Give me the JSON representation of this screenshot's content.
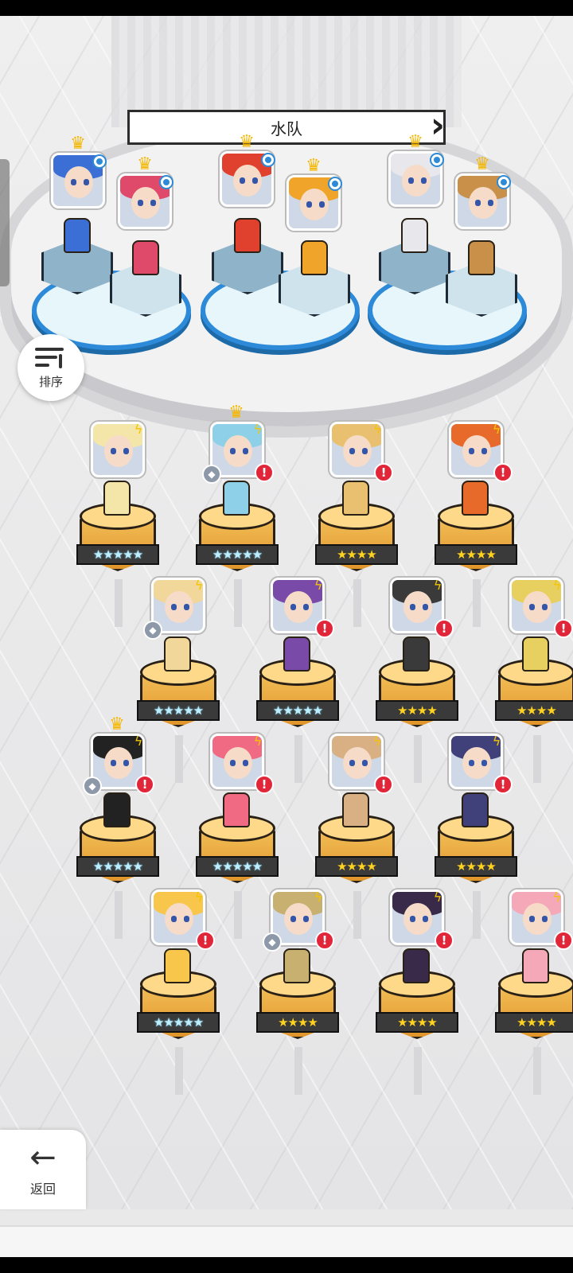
{
  "team": {
    "title": "水队",
    "prev_icon": "chevron-left-icon",
    "next_icon": "chevron-right-icon"
  },
  "sort_button": {
    "label": "排序",
    "icon": "sort-descending-icon"
  },
  "back_button": {
    "label": "返回",
    "icon": "arrow-left-icon"
  },
  "star_glyph": "★",
  "colors": {
    "team_ring": "#2d8ad8",
    "alert": "#e2263a",
    "gold_pedestal": "#f6c660",
    "five_star": "#bfefff",
    "four_star": "#ffd21f"
  },
  "team_members": [
    {
      "slot": 1,
      "hair": "#3c6fd6",
      "crown": true,
      "selected_marker": true
    },
    {
      "slot": 2,
      "hair": "#e04a6a",
      "crown": true,
      "selected_marker": true
    },
    {
      "slot": 3,
      "hair": "#e0402e",
      "crown": true,
      "selected_marker": true
    },
    {
      "slot": 4,
      "hair": "#f0a52a",
      "crown": true,
      "selected_marker": true
    },
    {
      "slot": 5,
      "hair": "#e8e8ec",
      "crown": true,
      "selected_marker": true
    },
    {
      "slot": 6,
      "hair": "#c89048",
      "crown": true,
      "selected_marker": true
    }
  ],
  "heroes": [
    {
      "stars": 5,
      "hair": "#f4e6a8",
      "crown": false,
      "alert": false,
      "gem": false,
      "bolt": true
    },
    {
      "stars": 5,
      "hair": "#8ed0e8",
      "crown": true,
      "alert": true,
      "gem": true,
      "bolt": true
    },
    {
      "stars": 4,
      "hair": "#e8c070",
      "crown": false,
      "alert": true,
      "gem": false,
      "bolt": true
    },
    {
      "stars": 4,
      "hair": "#e86a2a",
      "crown": false,
      "alert": true,
      "gem": false,
      "bolt": true
    },
    {
      "stars": 5,
      "hair": "#f2d79a",
      "crown": false,
      "alert": false,
      "gem": true,
      "bolt": true
    },
    {
      "stars": 5,
      "hair": "#7a4aa8",
      "crown": false,
      "alert": true,
      "gem": false,
      "bolt": true
    },
    {
      "stars": 4,
      "hair": "#3a3a3a",
      "crown": false,
      "alert": true,
      "gem": false,
      "bolt": true
    },
    {
      "stars": 4,
      "hair": "#e8d060",
      "crown": false,
      "alert": true,
      "gem": false,
      "bolt": true
    },
    {
      "stars": 5,
      "hair": "#222222",
      "crown": true,
      "alert": true,
      "gem": true,
      "bolt": true
    },
    {
      "stars": 5,
      "hair": "#f06a84",
      "crown": false,
      "alert": true,
      "gem": false,
      "bolt": true
    },
    {
      "stars": 4,
      "hair": "#d8b084",
      "crown": false,
      "alert": true,
      "gem": false,
      "bolt": true
    },
    {
      "stars": 4,
      "hair": "#40407a",
      "crown": false,
      "alert": true,
      "gem": false,
      "bolt": true
    },
    {
      "stars": 5,
      "hair": "#f7c64a",
      "crown": false,
      "alert": true,
      "gem": false,
      "bolt": true
    },
    {
      "stars": 4,
      "hair": "#c8b070",
      "crown": false,
      "alert": true,
      "gem": true,
      "bolt": true
    },
    {
      "stars": 4,
      "hair": "#3a2a4a",
      "crown": false,
      "alert": true,
      "gem": false,
      "bolt": true
    },
    {
      "stars": 4,
      "hair": "#f4a8b8",
      "crown": false,
      "alert": true,
      "gem": false,
      "bolt": true
    }
  ]
}
